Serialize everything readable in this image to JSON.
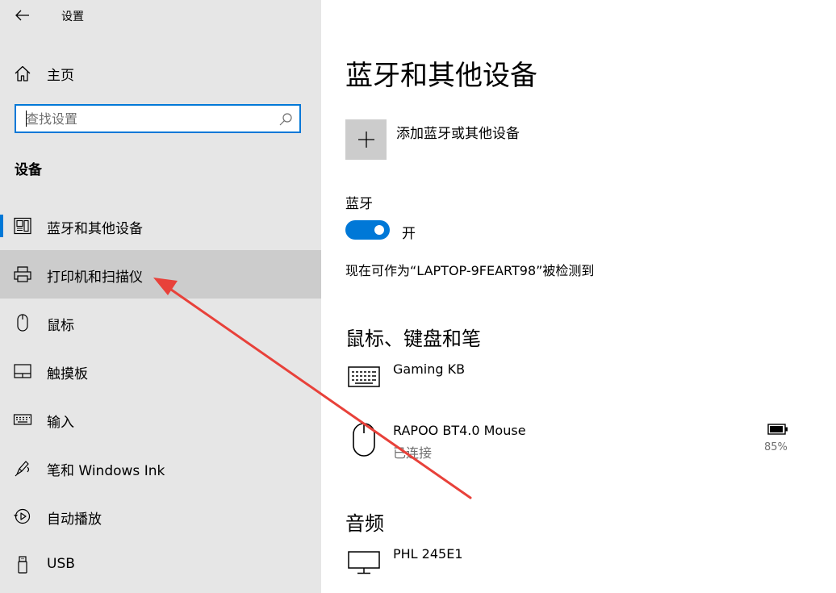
{
  "app": {
    "title": "设置"
  },
  "sidebar": {
    "home_label": "主页",
    "search_placeholder": "查找设置",
    "section_title": "设备",
    "items": [
      {
        "label": "蓝牙和其他设备",
        "icon": "bluetooth-devices-icon",
        "active": true
      },
      {
        "label": "打印机和扫描仪",
        "icon": "printer-icon",
        "hover": true
      },
      {
        "label": "鼠标",
        "icon": "mouse-icon"
      },
      {
        "label": "触摸板",
        "icon": "touchpad-icon"
      },
      {
        "label": "输入",
        "icon": "keyboard-icon"
      },
      {
        "label": "笔和 Windows Ink",
        "icon": "pen-icon"
      },
      {
        "label": "自动播放",
        "icon": "autoplay-icon"
      },
      {
        "label": "USB",
        "icon": "usb-icon"
      }
    ]
  },
  "main": {
    "title": "蓝牙和其他设备",
    "add_device_label": "添加蓝牙或其他设备",
    "bluetooth": {
      "label": "蓝牙",
      "toggle_state": "开",
      "toggle_on": true,
      "discoverable_text": "现在可作为“LAPTOP-9FEART98”被检测到"
    },
    "sections": [
      {
        "title": "鼠标、键盘和笔",
        "devices": [
          {
            "name": "Gaming KB",
            "status": "",
            "icon": "keyboard-icon"
          },
          {
            "name": "RAPOO BT4.0 Mouse",
            "status": "已连接",
            "icon": "mouse-icon",
            "battery": "85%"
          }
        ]
      },
      {
        "title": "音频",
        "devices": [
          {
            "name": "PHL 245E1",
            "status": "",
            "icon": "monitor-icon"
          }
        ]
      }
    ]
  },
  "colors": {
    "accent": "#0078d7",
    "sidebar_bg": "#e6e6e6",
    "hover_bg": "#cccccc",
    "annotation_arrow": "#e8413a"
  }
}
